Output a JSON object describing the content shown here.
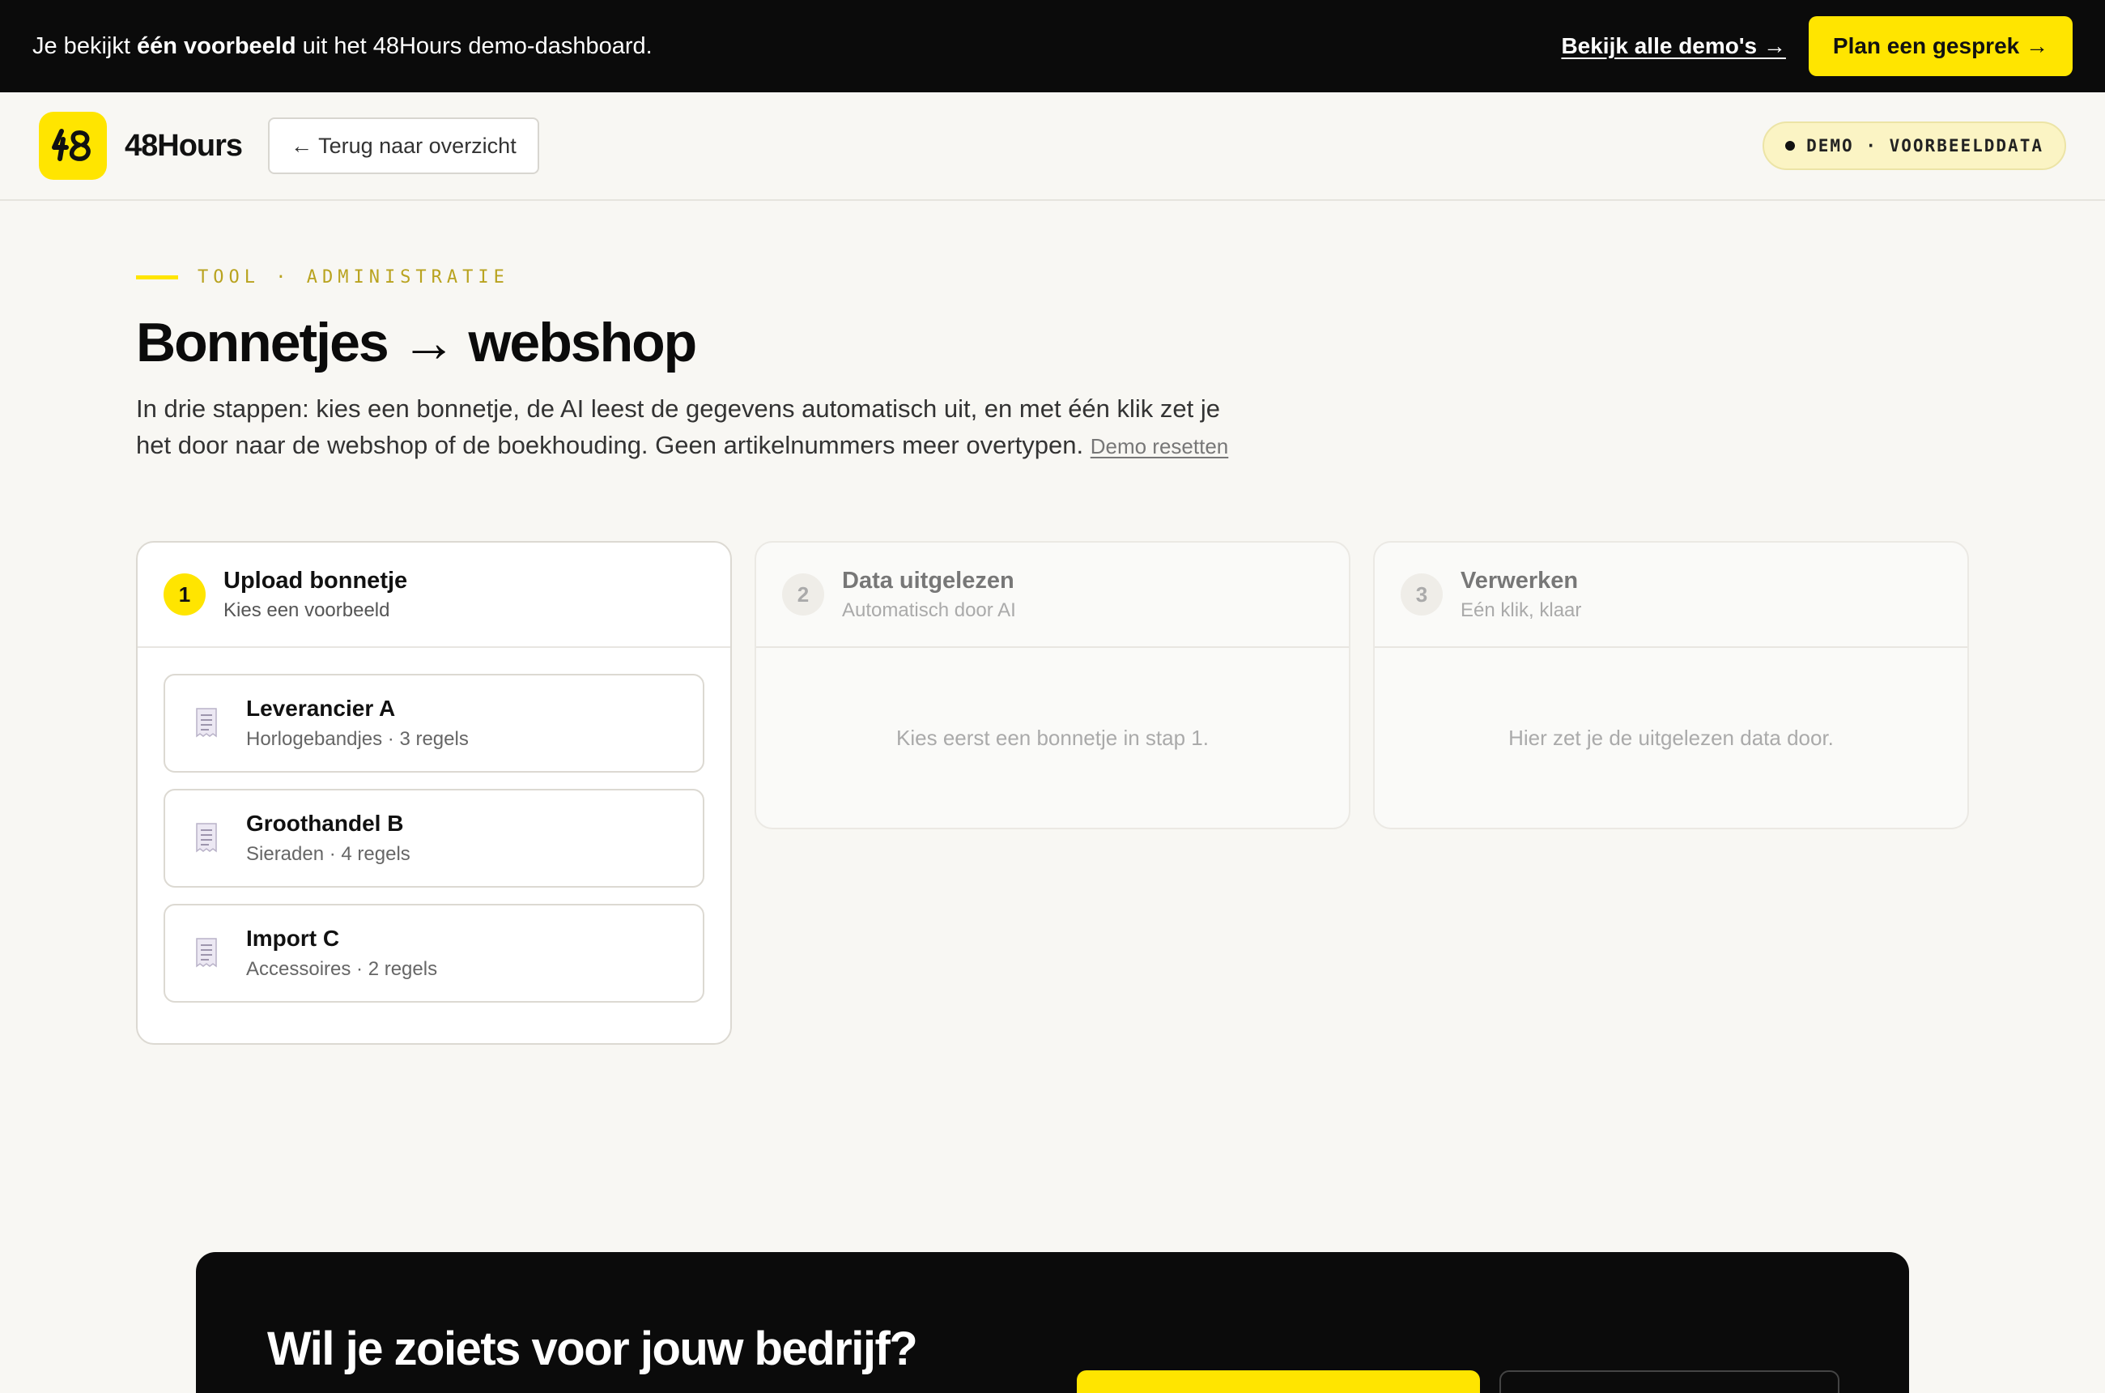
{
  "banner": {
    "prefix": "Je bekijkt ",
    "bold": "één voorbeeld",
    "suffix": " uit het 48Hours demo-dashboard.",
    "all_demos_link": "Bekijk alle demo's →",
    "plan_button": "Plan een gesprek →"
  },
  "header": {
    "logo_text": "48Hours",
    "back_button": "← Terug naar overzicht",
    "demo_badge": "DEMO · VOORBEELDDATA"
  },
  "hero": {
    "eyebrow": "TOOL · ADMINISTRATIE",
    "title": "Bonnetjes → webshop",
    "intro": "In drie stappen: kies een bonnetje, de AI leest de gegevens automatisch uit, en met één klik zet je het door naar de webshop of de boekhouding. Geen artikelnummers meer overtypen. ",
    "reset_link": "Demo resetten"
  },
  "steps": [
    {
      "number": "1",
      "title": "Upload bonnetje",
      "subtitle": "Kies een voorbeeld",
      "receipts": [
        {
          "name": "Leverancier A",
          "meta": "Horlogebandjes · 3 regels"
        },
        {
          "name": "Groothandel B",
          "meta": "Sieraden · 4 regels"
        },
        {
          "name": "Import C",
          "meta": "Accessoires · 2 regels"
        }
      ]
    },
    {
      "number": "2",
      "title": "Data uitgelezen",
      "subtitle": "Automatisch door AI",
      "empty": "Kies eerst een bonnetje in stap 1."
    },
    {
      "number": "3",
      "title": "Verwerken",
      "subtitle": "Eén klik, klaar",
      "empty": "Hier zet je de uitgelezen data door."
    }
  ],
  "cta": {
    "title": "Wil je zoiets voor jouw bedrijf?"
  },
  "colors": {
    "accent": "#ffe500",
    "dark": "#0b0b0b",
    "background": "#f8f7f3"
  },
  "icons": {
    "logo": "48-logo-icon",
    "receipt": "receipt-icon"
  }
}
